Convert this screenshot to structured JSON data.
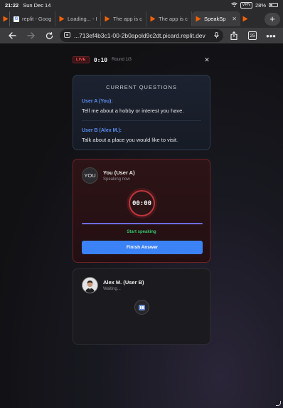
{
  "status_bar": {
    "time": "21:22",
    "date": "Sun Dec 14",
    "vpn": "VPN",
    "battery": "28%"
  },
  "tabs": [
    {
      "label": "",
      "favicon": "replit-icon"
    },
    {
      "label": "replit - Goog",
      "favicon": "google-icon"
    },
    {
      "label": "Loading... - R",
      "favicon": "replit-icon"
    },
    {
      "label": "The app is cu",
      "favicon": "replit-icon"
    },
    {
      "label": "The app is cu",
      "favicon": "replit-icon"
    },
    {
      "label": "SpeakSp",
      "favicon": "replit-icon",
      "active": true
    },
    {
      "label": "",
      "favicon": "replit-icon"
    }
  ],
  "toolbar": {
    "url": "...713ef4b3c1-00-2b0apold9c2dt.picard.replit.dev",
    "tab_count": "25"
  },
  "session": {
    "live_label": "LIVE",
    "timer": "0:10",
    "round": "Round 1/3"
  },
  "questions": {
    "title": "CURRENT QUESTIONS",
    "user_a_label": "User A (You):",
    "user_a_question": "Tell me about a hobby or interest you have.",
    "user_b_label": "User B (Alex M.):",
    "user_b_question": "Talk about a place you would like to visit."
  },
  "speaker_a": {
    "avatar_text": "YOU",
    "name": "You (User A)",
    "status": "Speaking now",
    "countdown": "00:00",
    "hint": "Start speaking",
    "button": "Finish Answer"
  },
  "speaker_b": {
    "name": "Alex M. (User B)",
    "status": "Waiting..."
  },
  "colors": {
    "accent_blue": "#3b82f6",
    "live_red": "#ff5555",
    "speaking_border": "#6e2228",
    "success_green": "#34c46a"
  }
}
